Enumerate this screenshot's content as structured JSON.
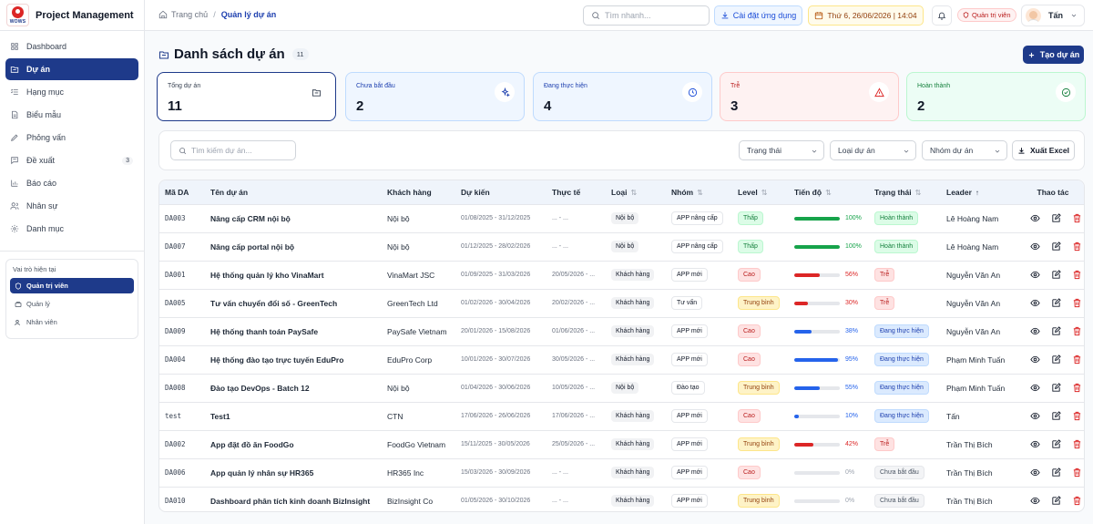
{
  "app": {
    "logo_text": "WOWS",
    "title": "Project Management"
  },
  "sidebar": {
    "items": [
      {
        "label": "Dashboard",
        "icon": "grid-icon"
      },
      {
        "label": "Dự án",
        "icon": "folder-icon",
        "active": true
      },
      {
        "label": "Hạng mục",
        "icon": "list-icon"
      },
      {
        "label": "Biểu mẫu",
        "icon": "document-icon"
      },
      {
        "label": "Phỏng vấn",
        "icon": "pen-icon"
      },
      {
        "label": "Đề xuất",
        "icon": "message-icon",
        "count": "3"
      },
      {
        "label": "Báo cáo",
        "icon": "bar-chart-icon"
      },
      {
        "label": "Nhân sự",
        "icon": "users-icon"
      },
      {
        "label": "Danh mục",
        "icon": "gear-icon"
      }
    ],
    "roles": {
      "title": "Vai trò hiện tại",
      "items": [
        {
          "label": "Quản trị viên",
          "active": true
        },
        {
          "label": "Quản lý"
        },
        {
          "label": "Nhân viên"
        }
      ]
    }
  },
  "topbar": {
    "breadcrumb": {
      "home": "Trang chủ",
      "current": "Quản lý dự án"
    },
    "search_placeholder": "Tìm nhanh...",
    "install_label": "Cài đặt ứng dụng",
    "datetime": "Thứ 6, 26/06/2026 | 14:04",
    "role_badge": "Quản trị viên",
    "user_name": "Tấn"
  },
  "page": {
    "title": "Danh sách dự án",
    "count": "11",
    "create_label": "Tạo dự án"
  },
  "stats": [
    {
      "label": "Tổng dự án",
      "value": "11",
      "bg": "#ffffff",
      "border": "#1e3a8a",
      "label_color": "#374151",
      "icon_color": "#374151"
    },
    {
      "label": "Chưa bắt đầu",
      "value": "2",
      "bg": "#eff6ff",
      "border": "#bfdbfe",
      "label_color": "#1e40af",
      "icon_color": "#1e40af"
    },
    {
      "label": "Đang thực hiện",
      "value": "4",
      "bg": "#eff6ff",
      "border": "#bfdbfe",
      "label_color": "#1e40af",
      "icon_color": "#1d4ed8"
    },
    {
      "label": "Trễ",
      "value": "3",
      "bg": "#fef2f2",
      "border": "#fecaca",
      "label_color": "#b91c1c",
      "icon_color": "#dc2626"
    },
    {
      "label": "Hoàn thành",
      "value": "2",
      "bg": "#ecfdf5",
      "border": "#bbf7d0",
      "label_color": "#15803d",
      "icon_color": "#15803d"
    }
  ],
  "filters": {
    "search_placeholder": "Tìm kiếm dự án...",
    "status": "Trạng thái",
    "type": "Loại dự án",
    "group": "Nhóm dự án",
    "export_label": "Xuất Excel"
  },
  "table": {
    "headers": {
      "code": "Mã DA",
      "name": "Tên dự án",
      "client": "Khách hàng",
      "planned": "Dự kiến",
      "actual": "Thực tế",
      "type": "Loại",
      "group": "Nhóm",
      "level": "Level",
      "progress": "Tiến độ",
      "status": "Trạng thái",
      "leader": "Leader",
      "actions": "Thao tác"
    },
    "rows": [
      {
        "code": "DA003",
        "name": "Nâng cấp CRM nội bộ",
        "client": "Nội bộ",
        "planned": "01/08/2025 - 31/12/2025",
        "actual": "... - ...",
        "type": "Nội bộ",
        "group": "APP nâng cấp",
        "level": "Thấp",
        "level_class": "low",
        "progress": 100,
        "progress_color": "#16a34a",
        "status": "Hoàn thành",
        "status_class": "done",
        "leader": "Lê Hoàng Nam"
      },
      {
        "code": "DA007",
        "name": "Nâng cấp portal nội bộ",
        "client": "Nội bộ",
        "planned": "01/12/2025 - 28/02/2026",
        "actual": "... - ...",
        "type": "Nội bộ",
        "group": "APP nâng cấp",
        "level": "Thấp",
        "level_class": "low",
        "progress": 100,
        "progress_color": "#16a34a",
        "status": "Hoàn thành",
        "status_class": "done",
        "leader": "Lê Hoàng Nam"
      },
      {
        "code": "DA001",
        "name": "Hệ thống quản lý kho VinaMart",
        "client": "VinaMart JSC",
        "planned": "01/09/2025 - 31/03/2026",
        "actual": "20/05/2026 - ...",
        "type": "Khách hàng",
        "group": "APP mới",
        "level": "Cao",
        "level_class": "high",
        "progress": 56,
        "progress_color": "#dc2626",
        "status": "Trễ",
        "status_class": "late",
        "leader": "Nguyễn Văn An"
      },
      {
        "code": "DA005",
        "name": "Tư vấn chuyển đổi số - GreenTech",
        "client": "GreenTech Ltd",
        "planned": "01/02/2026 - 30/04/2026",
        "actual": "20/02/2026 - ...",
        "type": "Khách hàng",
        "group": "Tư vấn",
        "level": "Trung bình",
        "level_class": "mid",
        "progress": 30,
        "progress_color": "#dc2626",
        "status": "Trễ",
        "status_class": "late",
        "leader": "Nguyễn Văn An"
      },
      {
        "code": "DA009",
        "name": "Hệ thống thanh toán PaySafe",
        "client": "PaySafe Vietnam",
        "planned": "20/01/2026 - 15/08/2026",
        "actual": "01/06/2026 - ...",
        "type": "Khách hàng",
        "group": "APP mới",
        "level": "Cao",
        "level_class": "high",
        "progress": 38,
        "progress_color": "#2563eb",
        "status": "Đang thực hiện",
        "status_class": "doing",
        "leader": "Nguyễn Văn An"
      },
      {
        "code": "DA004",
        "name": "Hệ thống đào tạo trực tuyến EduPro",
        "client": "EduPro Corp",
        "planned": "10/01/2026 - 30/07/2026",
        "actual": "30/05/2026 - ...",
        "type": "Khách hàng",
        "group": "APP mới",
        "level": "Cao",
        "level_class": "high",
        "progress": 95,
        "progress_color": "#2563eb",
        "status": "Đang thực hiện",
        "status_class": "doing",
        "leader": "Phạm Minh Tuấn"
      },
      {
        "code": "DA008",
        "name": "Đào tạo DevOps - Batch 12",
        "client": "Nội bộ",
        "planned": "01/04/2026 - 30/06/2026",
        "actual": "10/05/2026 - ...",
        "type": "Nội bộ",
        "group": "Đào tạo",
        "level": "Trung bình",
        "level_class": "mid",
        "progress": 55,
        "progress_color": "#2563eb",
        "status": "Đang thực hiện",
        "status_class": "doing",
        "leader": "Phạm Minh Tuấn"
      },
      {
        "code": "test",
        "name": "Test1",
        "client": "CTN",
        "planned": "17/06/2026 - 26/06/2026",
        "actual": "17/06/2026 - ...",
        "type": "Khách hàng",
        "group": "APP mới",
        "level": "Cao",
        "level_class": "high",
        "progress": 10,
        "progress_color": "#2563eb",
        "status": "Đang thực hiện",
        "status_class": "doing",
        "leader": "Tấn"
      },
      {
        "code": "DA002",
        "name": "App đặt đồ ăn FoodGo",
        "client": "FoodGo Vietnam",
        "planned": "15/11/2025 - 30/05/2026",
        "actual": "25/05/2026 - ...",
        "type": "Khách hàng",
        "group": "APP mới",
        "level": "Trung bình",
        "level_class": "mid",
        "progress": 42,
        "progress_color": "#dc2626",
        "status": "Trễ",
        "status_class": "late",
        "leader": "Trần Thị Bích"
      },
      {
        "code": "DA006",
        "name": "App quản lý nhân sự HR365",
        "client": "HR365 Inc",
        "planned": "15/03/2026 - 30/09/2026",
        "actual": "... - ...",
        "type": "Khách hàng",
        "group": "APP mới",
        "level": "Cao",
        "level_class": "high",
        "progress": 0,
        "progress_color": "#9ca3af",
        "status": "Chưa bắt đầu",
        "status_class": "new",
        "leader": "Trần Thị Bích"
      },
      {
        "code": "DA010",
        "name": "Dashboard phân tích kinh doanh BizInsight",
        "client": "BizInsight Co",
        "planned": "01/05/2026 - 30/10/2026",
        "actual": "... - ...",
        "type": "Khách hàng",
        "group": "APP mới",
        "level": "Trung bình",
        "level_class": "mid",
        "progress": 0,
        "progress_color": "#9ca3af",
        "status": "Chưa bắt đầu",
        "status_class": "new",
        "leader": "Trần Thị Bích"
      }
    ]
  }
}
